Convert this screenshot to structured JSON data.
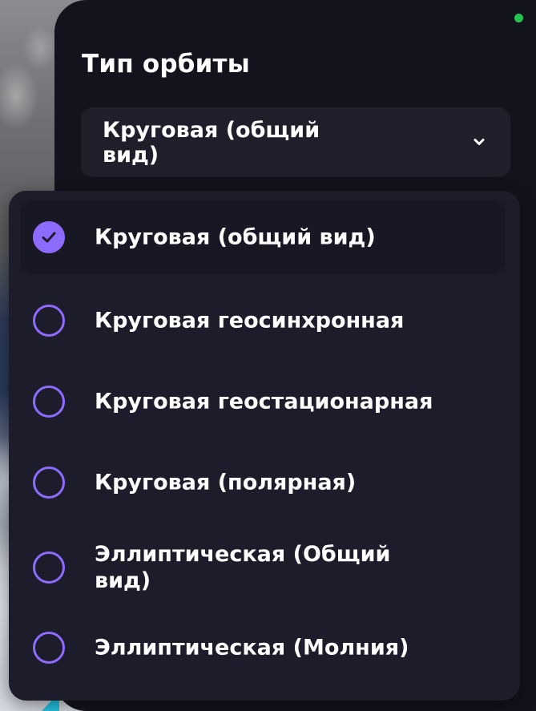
{
  "title": "Тип орбиты",
  "select": {
    "value": "Круговая (общий вид)"
  },
  "options": [
    {
      "label": "Круговая (общий вид)",
      "selected": true
    },
    {
      "label": "Круговая геосинхронная",
      "selected": false
    },
    {
      "label": "Круговая геостационарная",
      "selected": false
    },
    {
      "label": "Круговая (полярная)",
      "selected": false
    },
    {
      "label": "Эллиптическая (Общий вид)",
      "selected": false
    },
    {
      "label": "Эллиптическая (Молния)",
      "selected": false
    }
  ],
  "colors": {
    "accent": "#8d6bff",
    "panel": "#13131d",
    "dropdown": "#1c1c2a",
    "status": "#23c452"
  },
  "icons": {
    "chevron": "chevron-down-icon",
    "check": "check-icon"
  }
}
